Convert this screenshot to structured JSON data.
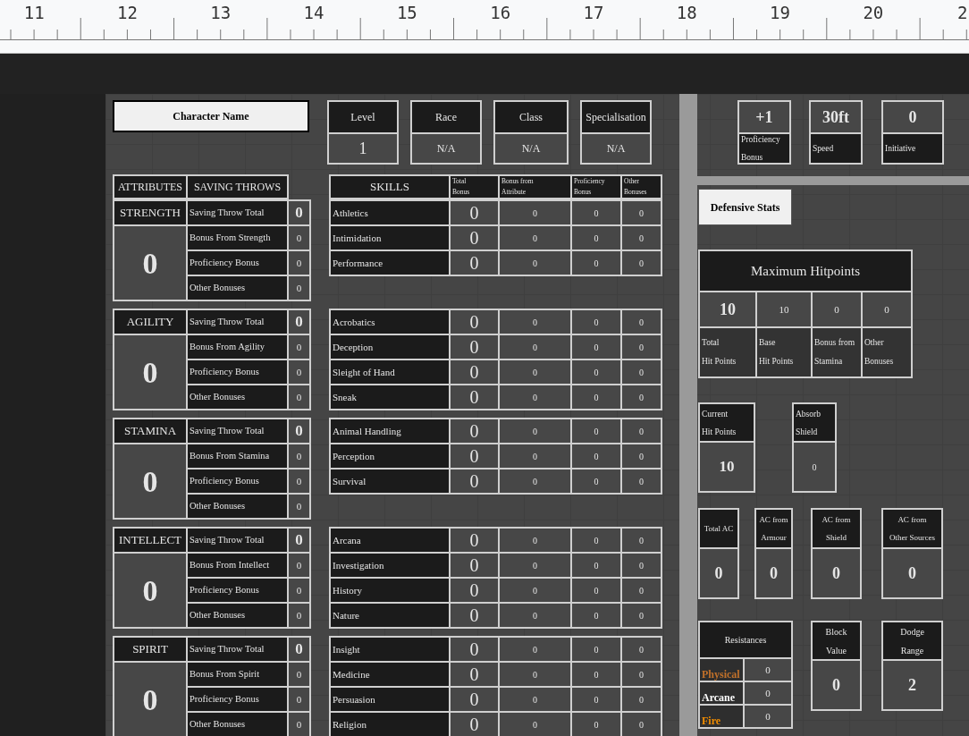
{
  "ruler": {
    "numbers": [
      "11",
      "12",
      "13",
      "14",
      "15",
      "16",
      "17",
      "18",
      "19",
      "20",
      "2"
    ]
  },
  "character_name": "Character Name",
  "info": [
    {
      "label": "Level",
      "value": "1"
    },
    {
      "label": "Race",
      "value": "N/A"
    },
    {
      "label": "Class",
      "value": "N/A"
    },
    {
      "label": "Specialisation",
      "value": "N/A"
    }
  ],
  "attributes_header": {
    "attributes": "ATTRIBUTES",
    "saving_throws": "SAVING THROWS"
  },
  "skills_header": {
    "title": "SKILLS",
    "columns": [
      "Total\nBonus",
      "Bonus from\nAttribute",
      "Proficiency\nBonus",
      "Other\n Bonuses"
    ]
  },
  "attributes": [
    {
      "name": "STRENGTH",
      "score": "0",
      "rows": [
        {
          "label": "Saving Throw Total",
          "value": "0"
        },
        {
          "label": "Bonus From Strength",
          "value": "0"
        },
        {
          "label": "Proficiency Bonus",
          "value": "0"
        },
        {
          "label": "Other Bonuses",
          "value": "0"
        }
      ],
      "skills": [
        {
          "name": "Athletics",
          "values": [
            "0",
            "0",
            "0",
            "0"
          ]
        },
        {
          "name": "Intimidation",
          "values": [
            "0",
            "0",
            "0",
            "0"
          ]
        },
        {
          "name": "Performance",
          "values": [
            "0",
            "0",
            "0",
            "0"
          ]
        }
      ]
    },
    {
      "name": "AGILITY",
      "score": "0",
      "rows": [
        {
          "label": "Saving Throw Total",
          "value": "0"
        },
        {
          "label": "Bonus From Agility",
          "value": "0"
        },
        {
          "label": "Proficiency Bonus",
          "value": "0"
        },
        {
          "label": "Other Bonuses",
          "value": "0"
        }
      ],
      "skills": [
        {
          "name": "Acrobatics",
          "values": [
            "0",
            "0",
            "0",
            "0"
          ]
        },
        {
          "name": "Deception",
          "values": [
            "0",
            "0",
            "0",
            "0"
          ]
        },
        {
          "name": "Sleight of Hand",
          "values": [
            "0",
            "0",
            "0",
            "0"
          ]
        },
        {
          "name": "Sneak",
          "values": [
            "0",
            "0",
            "0",
            "0"
          ]
        }
      ]
    },
    {
      "name": "STAMINA",
      "score": "0",
      "rows": [
        {
          "label": "Saving Throw Total",
          "value": "0"
        },
        {
          "label": "Bonus From Stamina",
          "value": "0"
        },
        {
          "label": "Proficiency Bonus",
          "value": "0"
        },
        {
          "label": "Other Bonuses",
          "value": "0"
        }
      ],
      "skills": [
        {
          "name": "Animal Handling",
          "values": [
            "0",
            "0",
            "0",
            "0"
          ]
        },
        {
          "name": "Perception",
          "values": [
            "0",
            "0",
            "0",
            "0"
          ]
        },
        {
          "name": "Survival",
          "values": [
            "0",
            "0",
            "0",
            "0"
          ]
        }
      ]
    },
    {
      "name": "INTELLECT",
      "score": "0",
      "rows": [
        {
          "label": "Saving Throw Total",
          "value": "0"
        },
        {
          "label": "Bonus From Intellect",
          "value": "0"
        },
        {
          "label": "Proficiency Bonus",
          "value": "0"
        },
        {
          "label": "Other Bonuses",
          "value": "0"
        }
      ],
      "skills": [
        {
          "name": "Arcana",
          "values": [
            "0",
            "0",
            "0",
            "0"
          ]
        },
        {
          "name": "Investigation",
          "values": [
            "0",
            "0",
            "0",
            "0"
          ]
        },
        {
          "name": "History",
          "values": [
            "0",
            "0",
            "0",
            "0"
          ]
        },
        {
          "name": "Nature",
          "values": [
            "0",
            "0",
            "0",
            "0"
          ]
        }
      ]
    },
    {
      "name": "SPIRIT",
      "score": "0",
      "rows": [
        {
          "label": "Saving Throw Total",
          "value": "0"
        },
        {
          "label": "Bonus From Spirit",
          "value": "0"
        },
        {
          "label": "Proficiency Bonus",
          "value": "0"
        },
        {
          "label": "Other Bonuses",
          "value": "0"
        }
      ],
      "skills": [
        {
          "name": "Insight",
          "values": [
            "0",
            "0",
            "0",
            "0"
          ]
        },
        {
          "name": "Medicine",
          "values": [
            "0",
            "0",
            "0",
            "0"
          ]
        },
        {
          "name": "Persuasion",
          "values": [
            "0",
            "0",
            "0",
            "0"
          ]
        },
        {
          "name": "Religion",
          "values": [
            "0",
            "0",
            "0",
            "0"
          ]
        }
      ]
    }
  ],
  "top_stats": [
    {
      "value": "+1",
      "label": "Proficiency\nBonus"
    },
    {
      "value": "30ft",
      "label": "Speed"
    },
    {
      "value": "0",
      "label": "Initiative"
    }
  ],
  "defensive_title": "Defensive Stats",
  "max_hitpoints": {
    "title": "Maximum Hitpoints",
    "cells": [
      {
        "value": "10",
        "label": "Total\nHit Points"
      },
      {
        "value": "10",
        "label": "Base\nHit Points"
      },
      {
        "value": "0",
        "label": "Bonus from\nStamina"
      },
      {
        "value": "0",
        "label": "Other\nBonuses"
      }
    ]
  },
  "current_hp": {
    "label": "Current\nHit Points",
    "value": "10"
  },
  "absorb_shield": {
    "label": "Absorb\nShield",
    "value": "0"
  },
  "armor_class": [
    {
      "label": "Total AC",
      "value": "0"
    },
    {
      "label": "AC from\nArmour",
      "value": "0"
    },
    {
      "label": "AC from\nShield",
      "value": "0"
    },
    {
      "label": "AC from\nOther Sources",
      "value": "0"
    }
  ],
  "resistances": {
    "title": "Resistances",
    "items": [
      {
        "name": "Physical",
        "color": "#c0702a",
        "value": "0"
      },
      {
        "name": "Arcane",
        "color": "#ffffff",
        "value": "0"
      },
      {
        "name": "Fire",
        "color": "#f08c00",
        "value": "0"
      }
    ]
  },
  "block": {
    "label": "Block\nValue",
    "value": "0"
  },
  "dodge": {
    "label": "Dodge\nRange",
    "value": "2"
  }
}
